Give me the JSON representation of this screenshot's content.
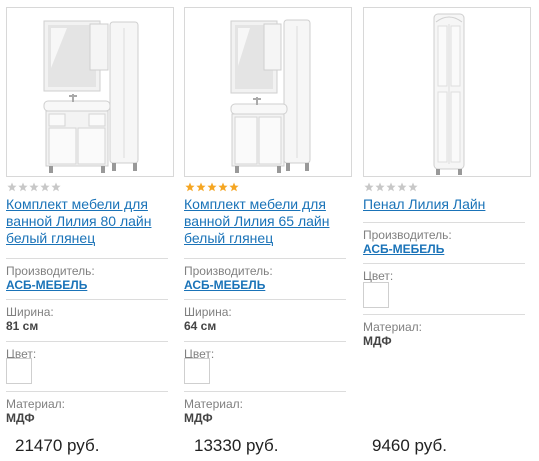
{
  "products": [
    {
      "title": "Комплект мебели для ванной Лилия 80 лайн белый глянец",
      "rating": 0,
      "manufacturer_label": "Производитель:",
      "manufacturer": "АСБ-МЕБЕЛЬ",
      "width_label": "Ширина:",
      "width": "81 см",
      "color_label": "Цвет:",
      "material_label": "Материал:",
      "material": "МДФ",
      "price": "21470 руб."
    },
    {
      "title": "Комплект мебели для ванной Лилия 65 лайн белый глянец",
      "rating": 5,
      "manufacturer_label": "Производитель:",
      "manufacturer": "АСБ-МЕБЕЛЬ",
      "width_label": "Ширина:",
      "width": "64 см",
      "color_label": "Цвет:",
      "material_label": "Материал:",
      "material": "МДФ",
      "price": "13330 руб."
    },
    {
      "title": "Пенал Лилия Лайн",
      "rating": 0,
      "manufacturer_label": "Производитель:",
      "manufacturer": "АСБ-МЕБЕЛЬ",
      "color_label": "Цвет:",
      "material_label": "Материал:",
      "material": "МДФ",
      "price": "9460 руб."
    }
  ],
  "colors": {
    "link": "#1a73b8",
    "star_on": "#f5a623",
    "star_off": "#c8c8c8"
  }
}
